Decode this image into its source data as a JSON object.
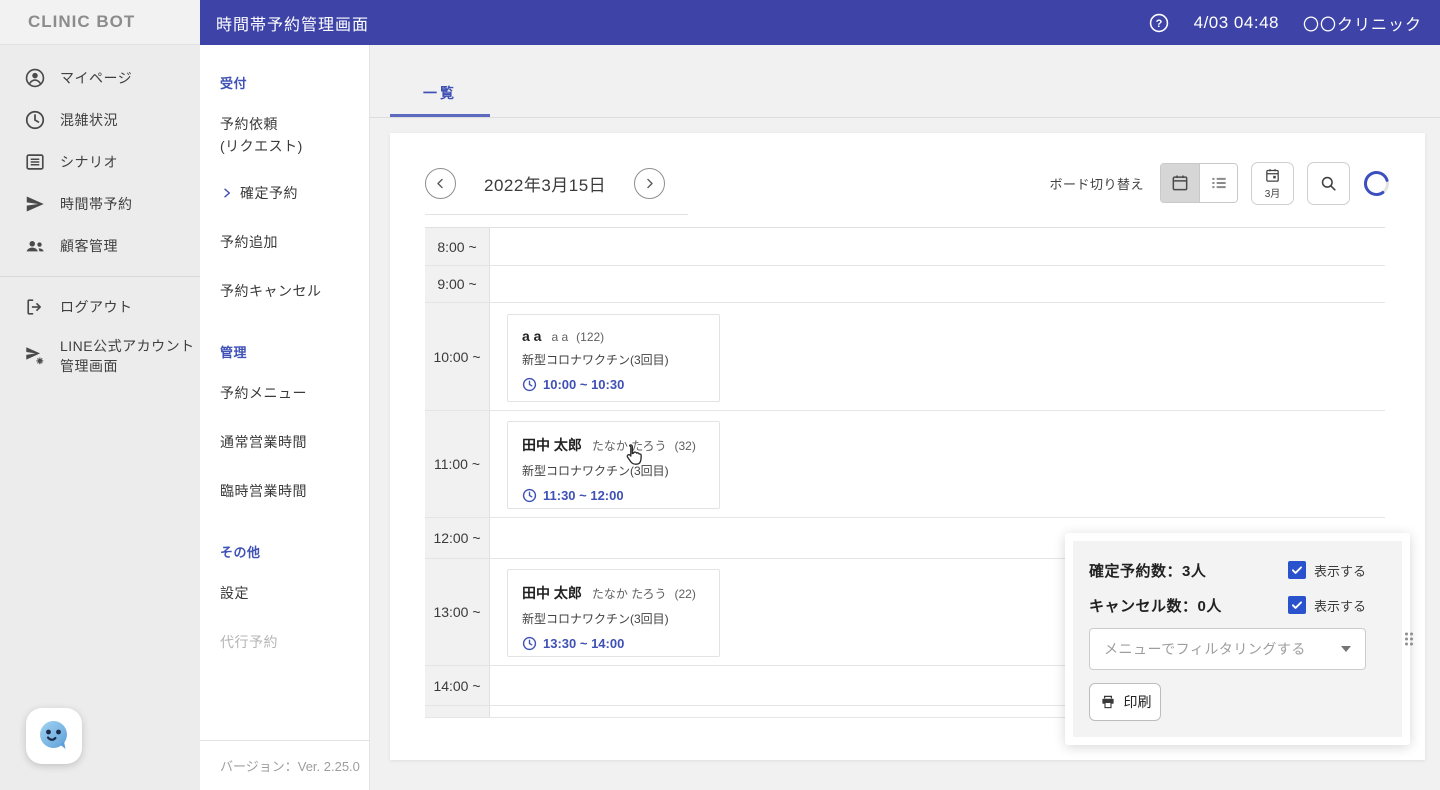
{
  "header": {
    "brand": "CLINIC BOT",
    "title": "時間帯予約管理画面",
    "datetime": "4/03 04:48",
    "clinic": "〇〇クリニック"
  },
  "sidebar": {
    "items": [
      {
        "icon": "person-icon",
        "label": "マイページ"
      },
      {
        "icon": "clock-icon",
        "label": "混雑状況"
      },
      {
        "icon": "scenario-icon",
        "label": "シナリオ"
      },
      {
        "icon": "send-icon",
        "label": "時間帯予約"
      },
      {
        "icon": "people-icon",
        "label": "顧客管理"
      },
      {
        "icon": "logout-icon",
        "label": "ログアウト"
      },
      {
        "icon": "line-manager-icon",
        "label": "LINE公式アカウント\n管理画面",
        "line1": "LINE公式アカウント",
        "line2": "管理画面"
      }
    ]
  },
  "submenu": {
    "reception": {
      "heading": "受付",
      "request1": "予約依頼",
      "request2": "(リクエスト)",
      "confirmed": "確定予約",
      "add": "予約追加",
      "cancel": "予約キャンセル"
    },
    "management": {
      "heading": "管理",
      "menu": "予約メニュー",
      "regular": "通常営業時間",
      "temporary": "臨時営業時間"
    },
    "other": {
      "heading": "その他",
      "settings": "設定",
      "proxy": "代行予約"
    },
    "version": "バージョン：Ver. 2.25.0"
  },
  "main": {
    "tab_list": "一覧",
    "date": "2022年3月15日",
    "board_label": "ボード切り替え",
    "month": "3月",
    "times": [
      "8:00 ~",
      "9:00 ~",
      "10:00 ~",
      "11:00 ~",
      "12:00 ~",
      "13:00 ~",
      "14:00 ~"
    ],
    "appointments": [
      {
        "name": "a a",
        "kana": "a a",
        "count": "(122)",
        "menu": "新型コロナワクチン(3回目)",
        "time": "10:00 ~ 10:30"
      },
      {
        "name": "田中 太郎",
        "kana": "たなか たろう",
        "count": "(32)",
        "menu": "新型コロナワクチン(3回目)",
        "time": "11:30 ~ 12:00"
      },
      {
        "name": "田中 太郎",
        "kana": "たなか たろう",
        "count": "(22)",
        "menu": "新型コロナワクチン(3回目)",
        "time": "13:30 ~ 14:00"
      }
    ]
  },
  "panel": {
    "confirmed": "確定予約数：3人",
    "cancelled": "キャンセル数：0人",
    "show": "表示する",
    "filter": "メニューでフィルタリングする",
    "print": "印刷"
  },
  "colors": {
    "header_blue": "#3E43A8",
    "accent_indigo": "#3F51B5",
    "checkbox_blue": "#2A52CC"
  }
}
